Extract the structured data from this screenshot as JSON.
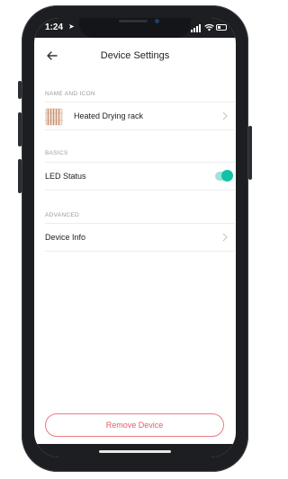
{
  "status_bar": {
    "time": "1:24",
    "location_icon": "location-arrow-icon",
    "signal_icon": "cellular-signal-icon",
    "wifi_icon": "wifi-icon",
    "battery_icon": "battery-icon"
  },
  "header": {
    "title": "Device Settings",
    "back_icon": "back-arrow-icon"
  },
  "sections": {
    "name_and_icon": {
      "label": "NAME AND ICON",
      "device_name": "Heated Drying rack",
      "icon": "heated-drying-rack-icon"
    },
    "basics": {
      "label": "BASICS",
      "led_status_label": "LED Status",
      "led_status_on": true
    },
    "advanced": {
      "label": "ADVANCED",
      "device_info_label": "Device Info"
    }
  },
  "actions": {
    "remove_device_label": "Remove Device"
  },
  "colors": {
    "accent_toggle": "#12c2a6",
    "danger": "#e25d6b",
    "frame": "#1c1e21"
  }
}
